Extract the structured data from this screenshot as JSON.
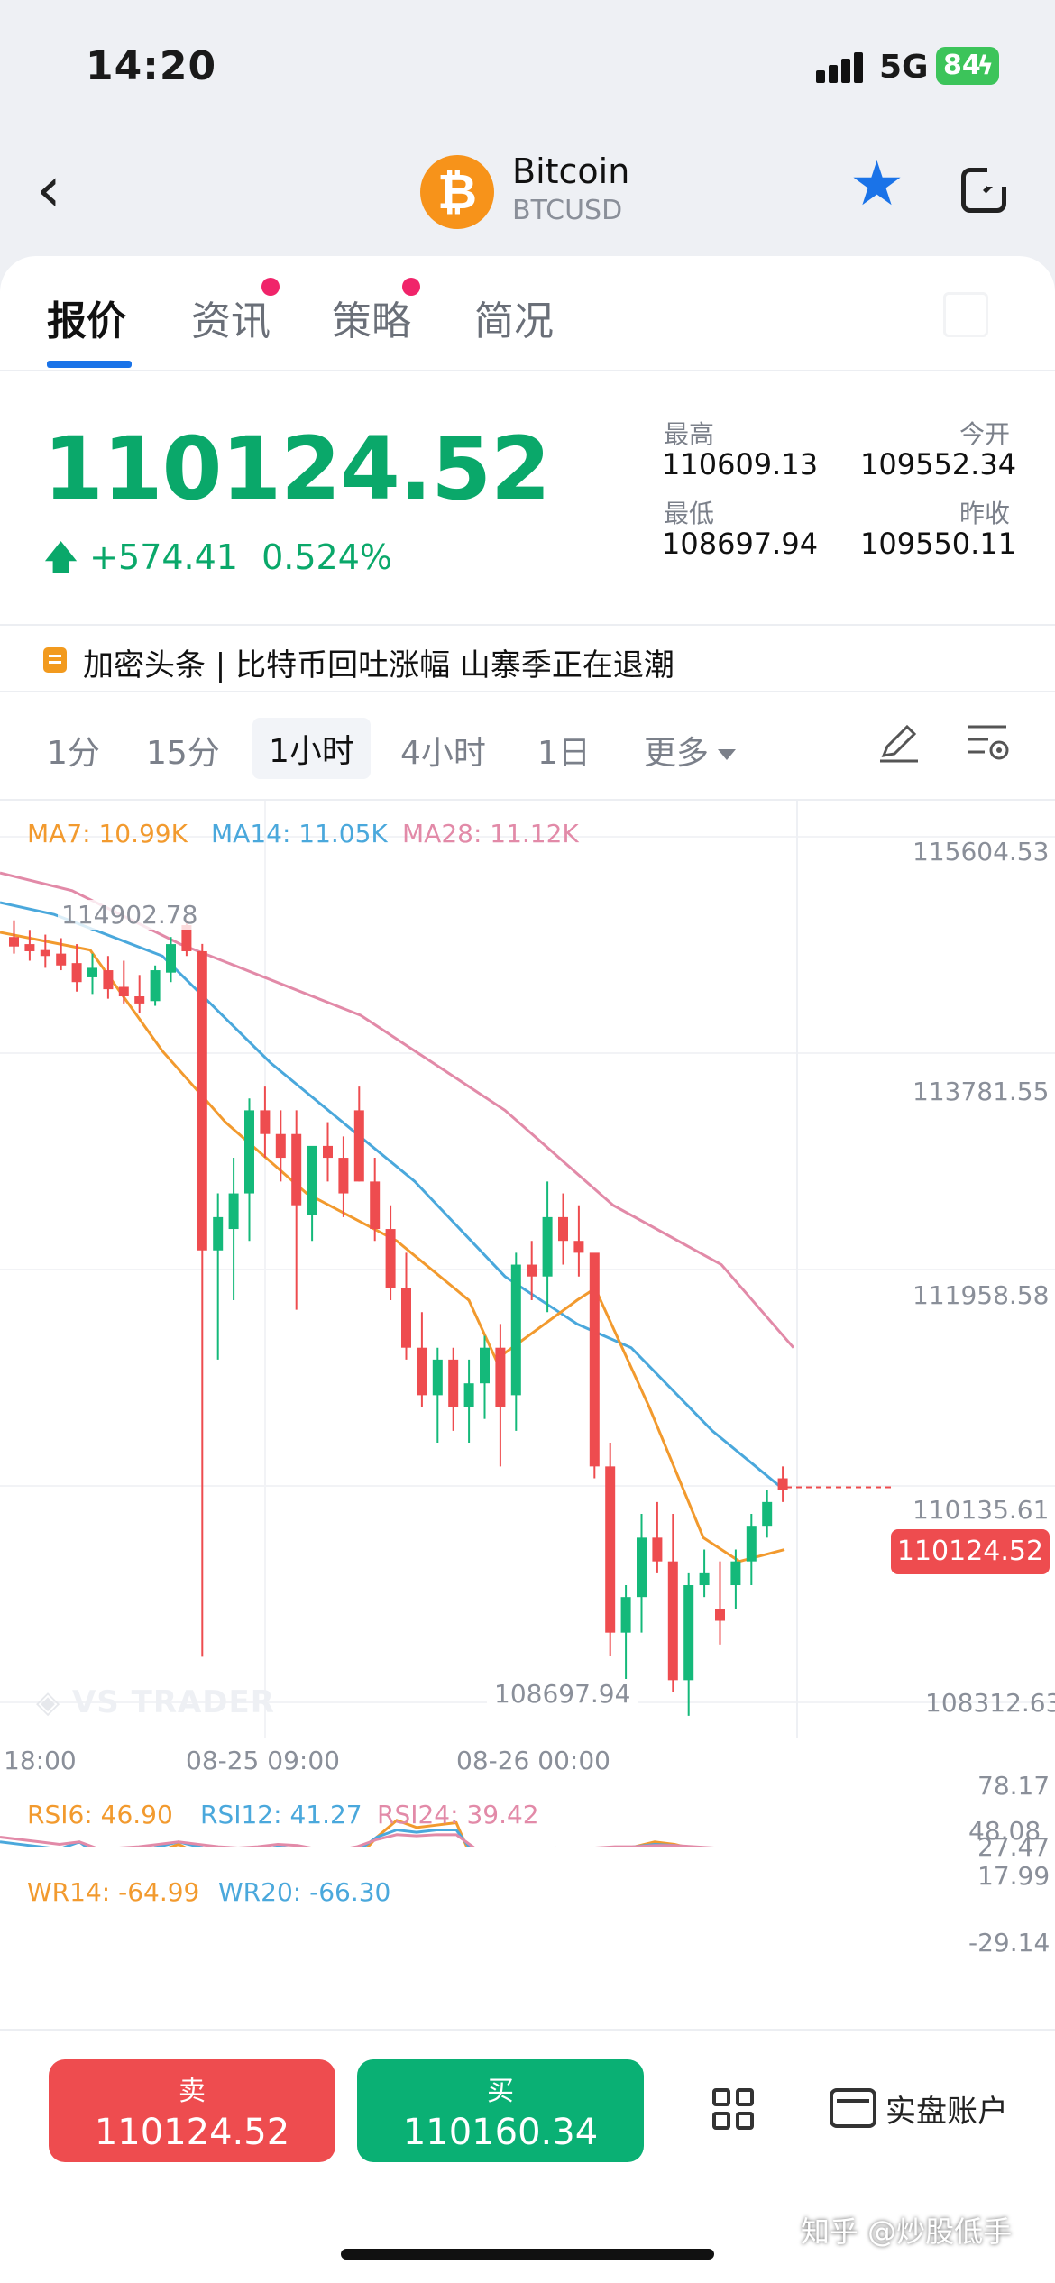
{
  "status": {
    "time": "14:20",
    "network": "5G",
    "battery": "84"
  },
  "header": {
    "coin_name": "Bitcoin",
    "coin_code": "BTCUSD",
    "coin_symbol": "₿"
  },
  "tabs": [
    "报价",
    "资讯",
    "策略",
    "简况"
  ],
  "quote": {
    "price": "110124.52",
    "change": "+574.41",
    "change_pct": "0.524%",
    "high_label": "最高",
    "high": "110609.13",
    "open_label": "今开",
    "open": "109552.34",
    "low_label": "最低",
    "low": "108697.94",
    "prev_close_label": "昨收",
    "prev_close": "109550.11"
  },
  "news": {
    "text": "加密头条 | 比特币回吐涨幅  山寨季正在退潮"
  },
  "intervals": [
    "1分",
    "15分",
    "1小时",
    "4小时",
    "1日",
    "更多"
  ],
  "chart": {
    "ma_legend": [
      "MA7: 10.99K",
      "MA14: 11.05K",
      "MA28: 11.12K"
    ],
    "y_ticks": [
      "115604.53",
      "113781.55",
      "111958.58",
      "110135.61",
      "108312.63"
    ],
    "high_mark": "114902.78",
    "low_mark": "108697.94",
    "current_tag": "110124.52",
    "x_ticks": [
      "18:00",
      "08-25 09:00",
      "08-26 00:00"
    ],
    "watermark": "VS TRADER",
    "rsi_legend": [
      "RSI6: 46.90",
      "RSI12: 41.27",
      "RSI24: 39.42"
    ],
    "rsi_ticks": [
      "78.17",
      "48.08",
      "17.99"
    ],
    "wr_legend": [
      "WR14: -64.99",
      "WR20: -66.30"
    ],
    "wr_ticks": [
      "27.47",
      "-29.14"
    ],
    "colors": {
      "up": "#14b97a",
      "down": "#ee4c4f",
      "ma7": "#f29a2e",
      "ma14": "#4aa8dc",
      "ma28": "#e28aa8"
    }
  },
  "bottom": {
    "sell_label": "卖",
    "sell_price": "110124.52",
    "buy_label": "买",
    "buy_price": "110160.34",
    "account_label": "实盘账户",
    "watermark": "知乎 @炒股低手"
  }
}
